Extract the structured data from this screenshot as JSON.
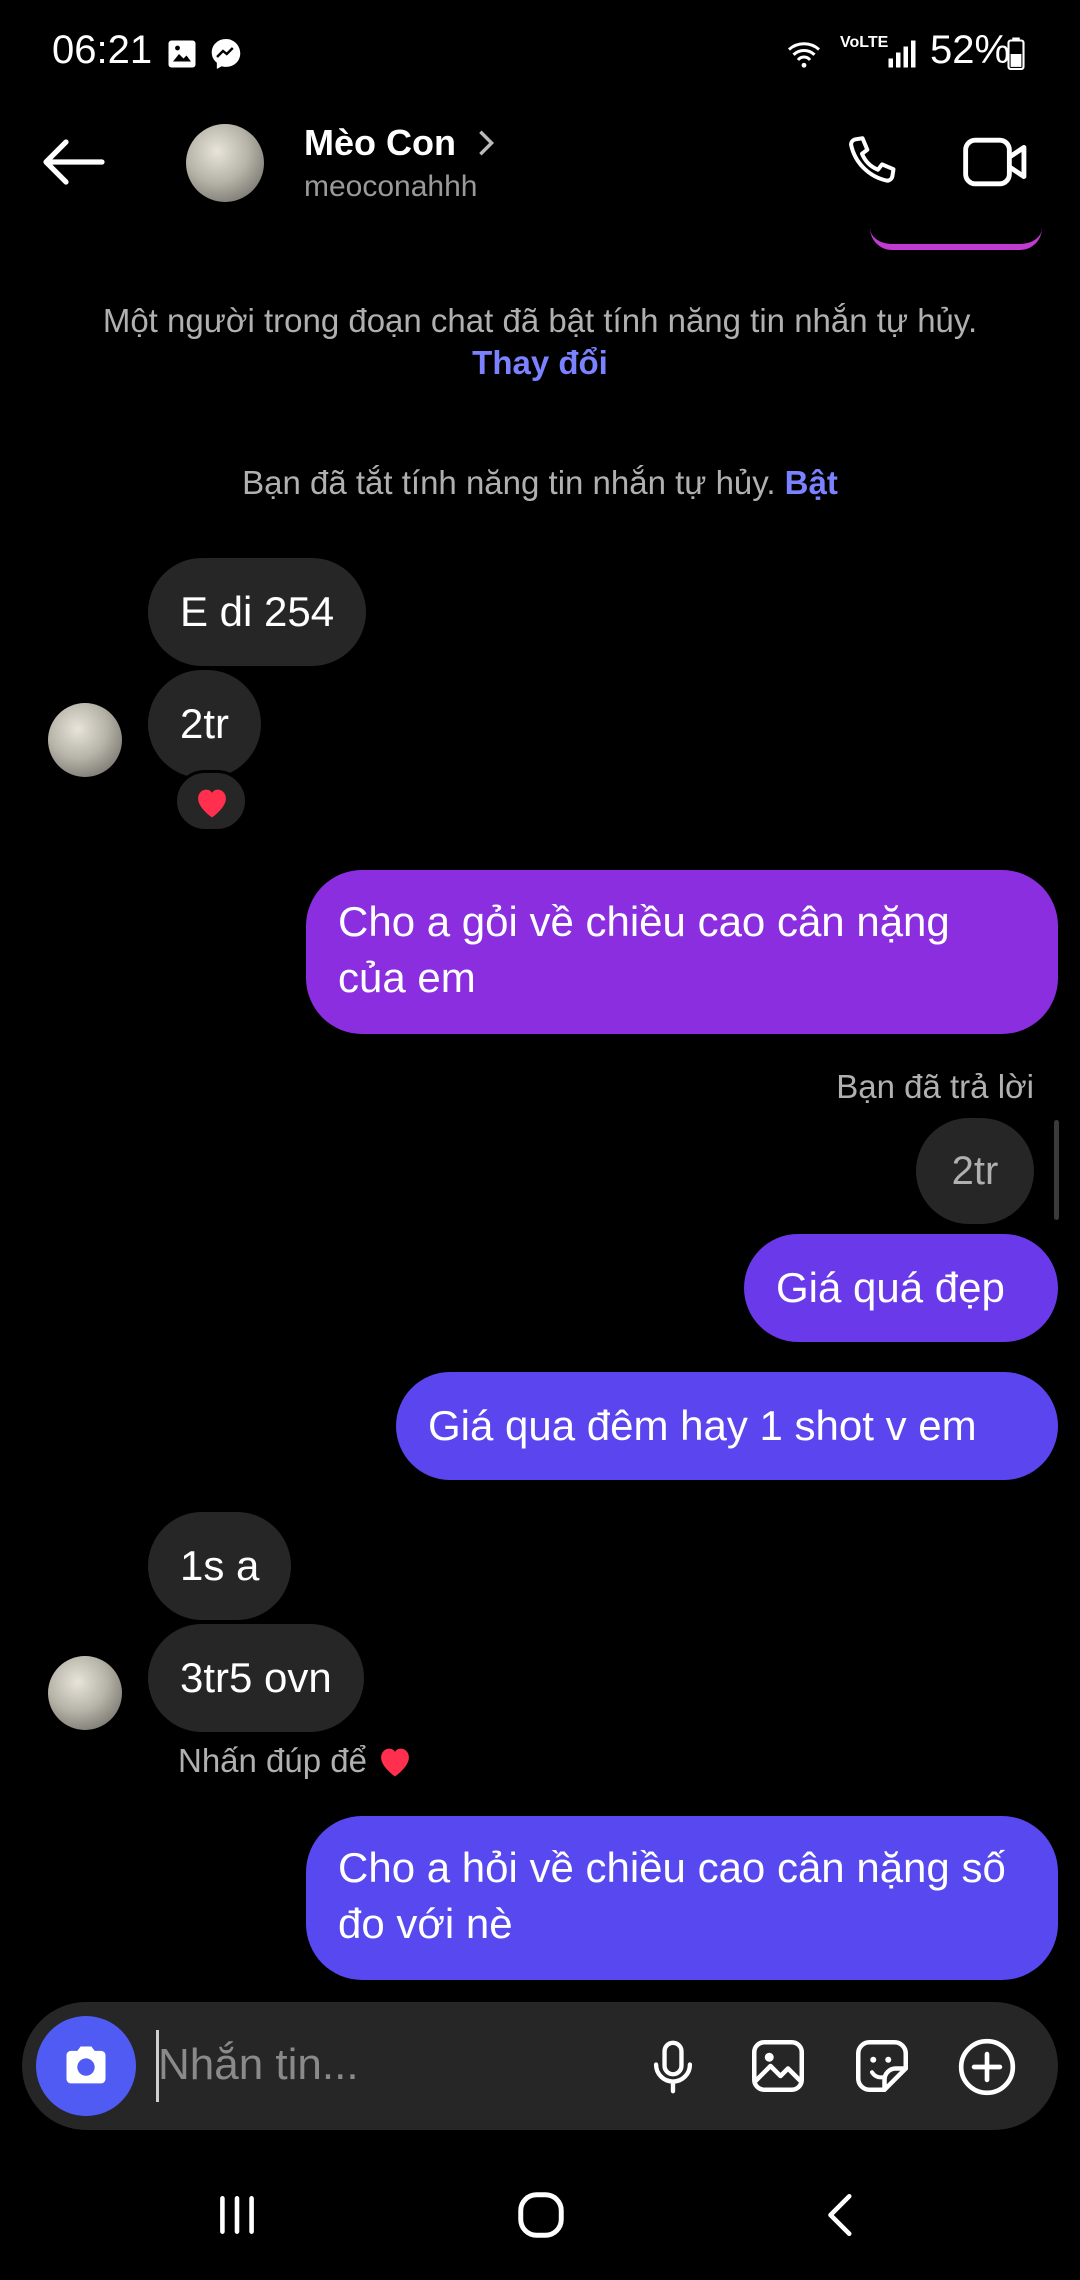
{
  "status_bar": {
    "time": "06:21",
    "network_label": "VoLTE",
    "battery": "52%"
  },
  "header": {
    "name": "Mèo Con",
    "username": "meoconahhh"
  },
  "system_messages": {
    "disappearing_on": "Một người trong đoạn chat đã bật tính năng tin nhắn tự hủy.",
    "disappearing_on_action": "Thay đổi",
    "disappearing_off": "Bạn đã tắt tính năng tin nhắn tự hủy.",
    "disappearing_off_action": "Bật"
  },
  "messages": {
    "in_1": "E di 254",
    "in_2": "2tr",
    "out_1": "Cho a gỏi về chiều cao cân nặng của em",
    "reply_label": "Bạn đã trả lời",
    "reply_quote": "2tr",
    "out_2": "Giá quá đẹp",
    "out_3": "Giá qua đêm hay 1 shot v em",
    "in_3": "1s a",
    "in_4": "3tr5 ovn",
    "double_tap_hint": "Nhấn đúp để",
    "out_4": "Cho a hỏi về chiều cao cân nặng số đo với nè"
  },
  "composer": {
    "placeholder": "Nhắn tin..."
  },
  "colors": {
    "bubble_in": "#262626",
    "out_purple": "#8a2ee0",
    "out_indigo": "#5748ef",
    "link": "#7b82ff",
    "camera_button": "#4f5bf2"
  },
  "icons": [
    "photo-icon",
    "messenger-icon",
    "wifi-icon",
    "volte-icon",
    "signal-icon",
    "battery-icon",
    "back-arrow-icon",
    "chevron-right-icon",
    "phone-icon",
    "video-icon",
    "heart-icon",
    "camera-icon",
    "mic-icon",
    "gallery-icon",
    "sticker-icon",
    "plus-circle-icon",
    "recents-icon",
    "home-icon",
    "back-nav-icon"
  ]
}
